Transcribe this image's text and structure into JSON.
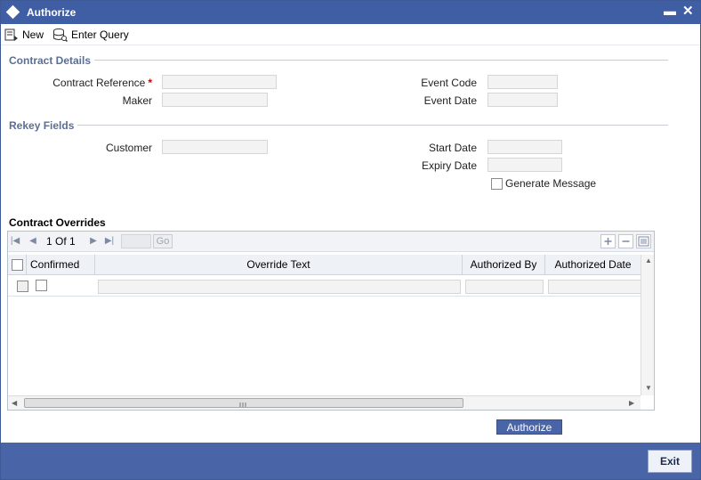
{
  "window": {
    "title": "Authorize",
    "minimize": "▬",
    "close": "✕"
  },
  "toolbar": {
    "new_label": "New",
    "enter_query_label": "Enter Query"
  },
  "contract_details": {
    "title": "Contract Details",
    "contract_reference_label": "Contract Reference",
    "required_mark": "*",
    "maker_label": "Maker",
    "event_code_label": "Event Code",
    "event_date_label": "Event Date",
    "contract_reference_value": "",
    "maker_value": "",
    "event_code_value": "",
    "event_date_value": ""
  },
  "rekey_fields": {
    "title": "Rekey Fields",
    "customer_label": "Customer",
    "start_date_label": "Start Date",
    "expiry_date_label": "Expiry Date",
    "generate_message_label": "Generate Message",
    "customer_value": "",
    "start_date_value": "",
    "expiry_date_value": ""
  },
  "overrides": {
    "title": "Contract Overrides",
    "page_current": "1",
    "page_of": "Of",
    "page_total": "1",
    "go_label": "Go",
    "columns": [
      "Confirmed",
      "Override Text",
      "Authorized By",
      "Authorized Date"
    ]
  },
  "actions": {
    "authorize_label": "Authorize",
    "exit_label": "Exit"
  },
  "colors": {
    "title_bar": "#3f5ea3",
    "footer": "#4a64a8",
    "section_title": "#5a6f95",
    "required": "#cc0000"
  }
}
